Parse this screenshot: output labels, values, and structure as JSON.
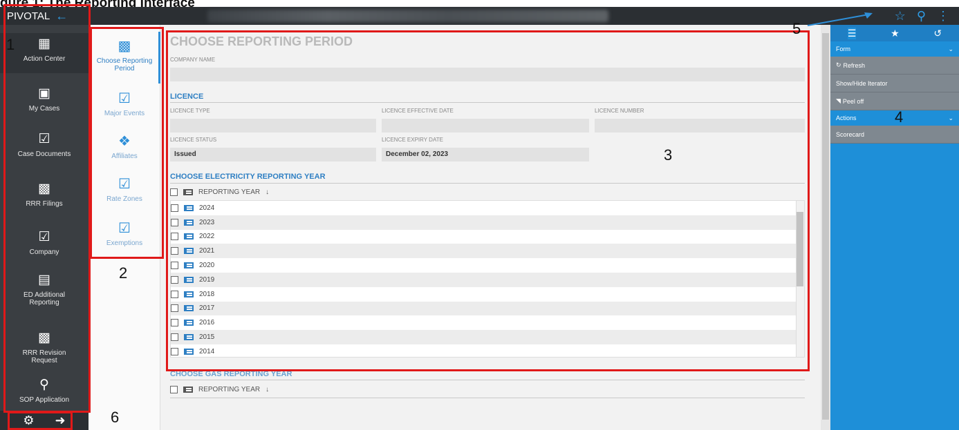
{
  "document_title": "gure 1: The Reporting Interface",
  "brand": {
    "name": "PIVOTAL"
  },
  "nav": {
    "items": [
      {
        "label": "Action Center",
        "icon": "dashboard-icon"
      },
      {
        "label": "My Cases",
        "icon": "briefcase-icon"
      },
      {
        "label": "Case Documents",
        "icon": "checkbox-icon"
      },
      {
        "label": "RRR Filings",
        "icon": "building-icon"
      },
      {
        "label": "Company",
        "icon": "checkbox-icon"
      },
      {
        "label": "ED Additional Reporting",
        "icon": "document-icon"
      },
      {
        "label": "RRR Revision Request",
        "icon": "building-icon"
      },
      {
        "label": "SOP Application",
        "icon": "globe-search-icon"
      }
    ]
  },
  "subnav": {
    "items": [
      {
        "label": "Choose Reporting Period",
        "icon": "building-check-icon",
        "active": true
      },
      {
        "label": "Major Events",
        "icon": "checkbox-icon"
      },
      {
        "label": "Affiliates",
        "icon": "handshake-icon"
      },
      {
        "label": "Rate Zones",
        "icon": "checkbox-icon"
      },
      {
        "label": "Exemptions",
        "icon": "checkbox-icon"
      }
    ]
  },
  "main": {
    "title": "CHOOSE REPORTING PERIOD",
    "company_name_label": "COMPANY NAME",
    "licence": {
      "section_title": "LICENCE",
      "type_label": "LICENCE TYPE",
      "effective_date_label": "LICENCE EFFECTIVE DATE",
      "number_label": "LICENCE NUMBER",
      "status_label": "LICENCE STATUS",
      "status_value": "Issued",
      "expiry_label": "LICENCE EXPIRY DATE",
      "expiry_value": "December 02, 2023"
    },
    "electricity": {
      "section_title": "CHOOSE ELECTRICITY REPORTING YEAR",
      "column_header": "REPORTING YEAR",
      "sort_glyph": "↓",
      "rows": [
        "2024",
        "2023",
        "2022",
        "2021",
        "2020",
        "2019",
        "2018",
        "2017",
        "2016",
        "2015",
        "2014"
      ]
    },
    "gas": {
      "section_title": "CHOOSE GAS REPORTING YEAR",
      "column_header": "REPORTING YEAR",
      "sort_glyph": "↓"
    }
  },
  "right_panel": {
    "form_label": "Form",
    "items": [
      "Refresh",
      "Show/Hide Iterator",
      "Peel off"
    ],
    "actions_label": "Actions",
    "action_items": [
      "Scorecard"
    ]
  },
  "callouts": [
    "1",
    "2",
    "3",
    "4",
    "5",
    "6"
  ],
  "colors": {
    "accent": "#2e8fd8",
    "highlight": "#e01919",
    "nav_bg": "#3a3e42",
    "panel_bg": "#1e8fd8"
  }
}
